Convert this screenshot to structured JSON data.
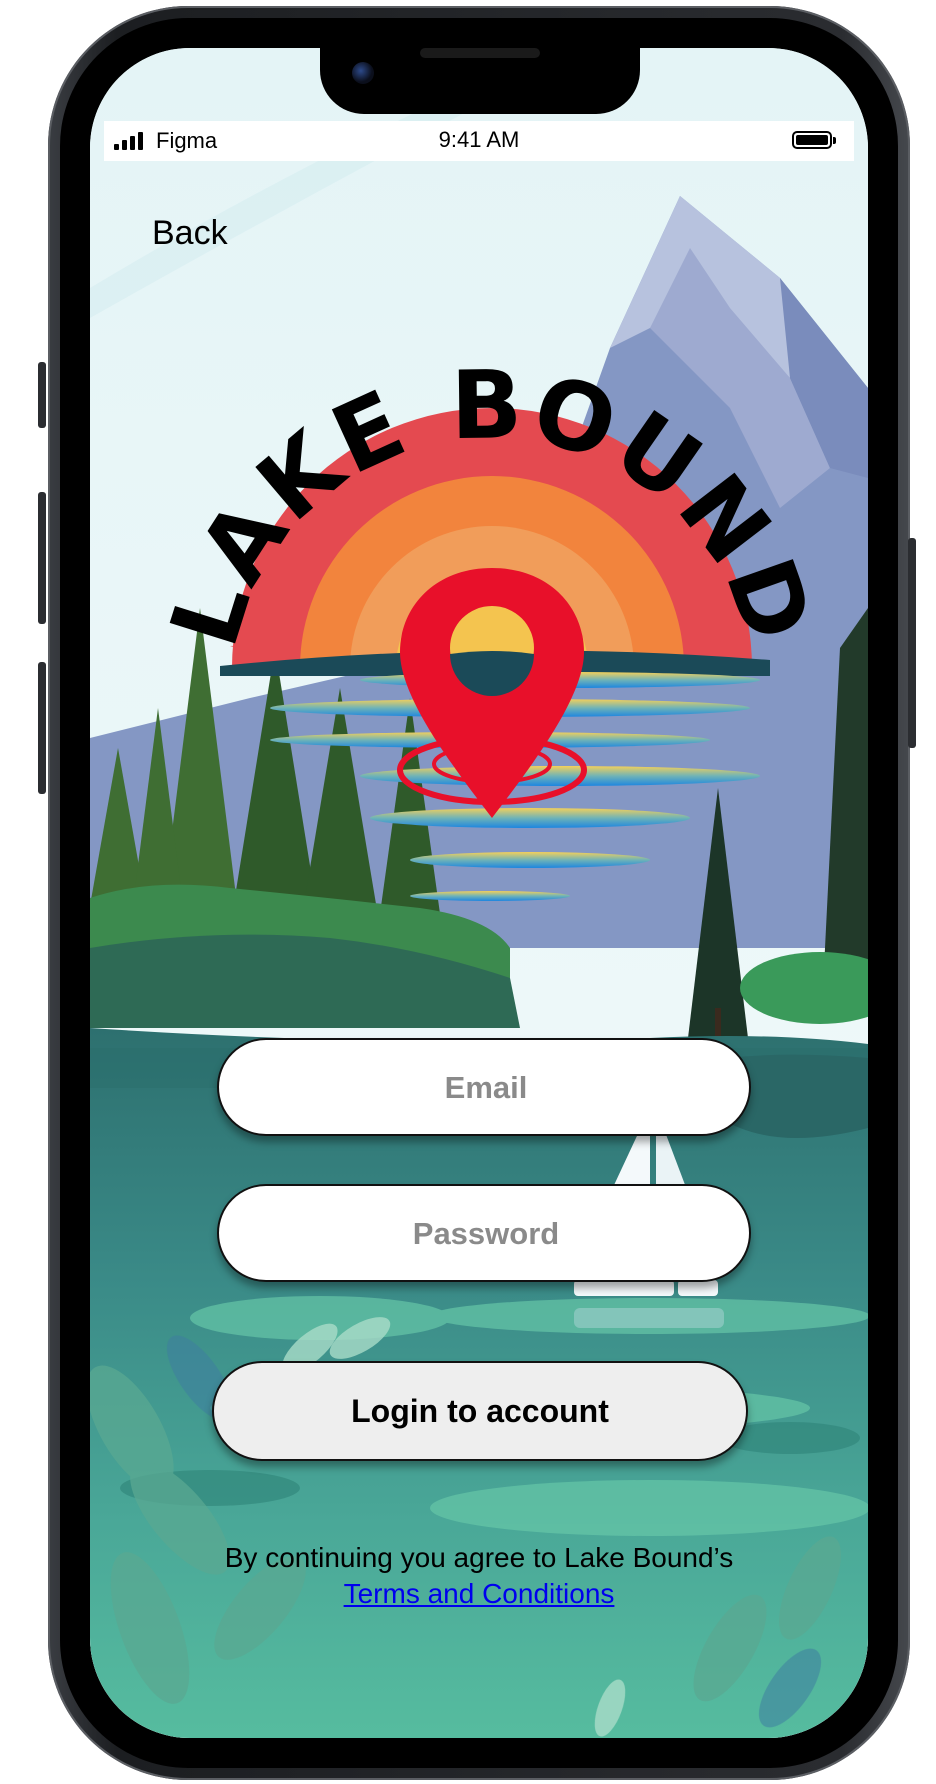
{
  "status_bar": {
    "carrier": "Figma",
    "time": "9:41 AM"
  },
  "nav": {
    "back_label": "Back"
  },
  "logo": {
    "text": "LAKE BOUND"
  },
  "form": {
    "email_placeholder": "Email",
    "password_placeholder": "Password",
    "login_label": "Login to account"
  },
  "legal": {
    "agreement_text": "By continuing you agree to Lake Bound’s",
    "terms_link": "Terms and Conditions"
  },
  "colors": {
    "pin": "#e8102a",
    "sun_outer": "#e44a50",
    "sun_inner": "#f4c44f",
    "lake": "#3a8a87",
    "mountain": "#8497c4",
    "input_bg": "#ffffff",
    "button_bg": "#eeeeee",
    "link": "#0000ee"
  }
}
